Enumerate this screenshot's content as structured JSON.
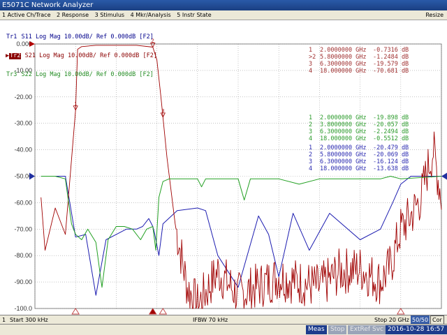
{
  "window": {
    "title": "E5071C Network Analyzer"
  },
  "menu": {
    "items": [
      "1 Active Ch/Trace",
      "2 Response",
      "3 Stimulus",
      "4 Mkr/Analysis",
      "5 Instr State"
    ],
    "resize_label": "Resize"
  },
  "traces_header": [
    {
      "id": "Tr1",
      "text": " S11 Log Mag 10.00dB/ Ref 0.000dB [F2]",
      "color": "#00008b"
    },
    {
      "id": "Tr2",
      "text": " S21 Log Mag 10.00dB/ Ref 0.000dB [F2]",
      "color": "#8b0000",
      "active": true
    },
    {
      "id": "Tr3",
      "text": " S22 Log Mag 10.00dB/ Ref 0.000dB [F2]",
      "color": "#228b22"
    }
  ],
  "status": {
    "channel": "1",
    "start": "Start 300 kHz",
    "ifbw": "IFBW 70 kHz",
    "stop": "Stop 20 GHz",
    "cor": "Cor"
  },
  "bottom": {
    "meas": "Meas",
    "stop": "Stop",
    "extref": "ExtRef",
    "svc": "Svc",
    "datetime": "2016-10-28 16:57"
  },
  "colors": {
    "s11": "#1c1cb0",
    "s21": "#a00000",
    "s22": "#22a022",
    "grid": "#a0a0a0"
  },
  "chart_data": {
    "type": "line",
    "ylim": [
      -100,
      0
    ],
    "xlim_ghz": [
      0.0003,
      20
    ],
    "y_tick_labels": [
      "0.000",
      "-10.00",
      "-20.00",
      "-30.00",
      "-40.00",
      "-50.00",
      "-60.00",
      "-70.00",
      "-80.00",
      "-90.00",
      "-100.0"
    ],
    "y_ticks": [
      0,
      -10,
      -20,
      -30,
      -40,
      -50,
      -60,
      -70,
      -80,
      -90,
      -100
    ],
    "grid": true,
    "series": [
      {
        "name": "S11",
        "x": [
          0.3,
          1.5,
          2.0,
          2.5,
          3.0,
          3.5,
          4.0,
          4.5,
          5.0,
          5.3,
          5.6,
          5.8,
          5.9,
          6.1,
          6.3,
          7.0,
          8.0,
          8.4,
          9.0,
          10.0,
          11.0,
          11.5,
          12.0,
          12.7,
          13.5,
          14.5,
          16.0,
          17.0,
          17.6,
          18.0,
          18.5,
          19.0,
          20.0
        ],
        "y": [
          -50,
          -50,
          -73,
          -72,
          -95,
          -74,
          -72,
          -70,
          -70,
          -69,
          -66,
          -69,
          -72,
          -80,
          -68,
          -63,
          -62,
          -63,
          -80,
          -92,
          -65,
          -72,
          -88,
          -64,
          -78,
          -64,
          -74,
          -70,
          -60,
          -53,
          -50,
          -50,
          -50
        ]
      },
      {
        "name": "S21",
        "x": [
          0.3,
          0.5,
          1.0,
          1.5,
          2.0,
          2.1,
          2.3,
          3.0,
          4.0,
          5.0,
          5.8,
          6.0,
          6.2,
          6.5,
          6.9,
          7.5,
          8.0,
          9.0,
          10.0,
          12.0,
          14.0,
          15.0,
          16.0,
          17.0,
          17.5,
          18.0,
          18.5,
          19.0,
          19.3,
          19.6,
          20.0
        ],
        "y": [
          -58,
          -78,
          -62,
          -72,
          -25,
          -2,
          -1,
          -0.5,
          -0.5,
          -0.5,
          -1.2,
          -6,
          -20,
          -43,
          -68,
          -92,
          -99,
          -86,
          -95,
          -88,
          -92,
          -86,
          -85,
          -90,
          -84,
          -70,
          -65,
          -58,
          -48,
          -40,
          -58
        ]
      },
      {
        "name": "S22",
        "x": [
          0.3,
          1.0,
          1.5,
          1.8,
          2.0,
          2.3,
          2.6,
          3.0,
          3.3,
          3.6,
          4.0,
          4.4,
          4.8,
          5.2,
          5.5,
          5.8,
          5.95,
          6.1,
          6.3,
          6.6,
          8.0,
          8.2,
          8.4,
          10.0,
          10.3,
          10.6,
          12.0,
          13.0,
          14.0,
          15.0,
          16.0,
          17.0,
          17.5,
          18.0,
          20.0
        ],
        "y": [
          -50,
          -50,
          -51,
          -68,
          -72,
          -74,
          -70,
          -75,
          -92,
          -74,
          -69,
          -69,
          -70,
          -74,
          -70,
          -69,
          -78,
          -58,
          -52,
          -51,
          -51,
          -54,
          -51,
          -51,
          -59,
          -51,
          -51,
          -53,
          -51,
          -51,
          -51,
          -51,
          -50,
          -51,
          -50
        ]
      }
    ],
    "marker_tables": [
      {
        "series": "S21",
        "color": "#a03030",
        "rows": [
          {
            "no": "1",
            "freq": "2.0000000 GHz",
            "value": "-0.7316 dB"
          },
          {
            "no": ">2",
            "freq": "5.8000000 GHz",
            "value": "-1.2484 dB"
          },
          {
            "no": "3",
            "freq": "6.3000000 GHz",
            "value": "-19.579 dB"
          },
          {
            "no": "4",
            "freq": "18.000000 GHz",
            "value": "-70.681 dB"
          }
        ]
      },
      {
        "series": "S22",
        "color": "#2a9a2a",
        "rows": [
          {
            "no": "1",
            "freq": "2.0000000 GHz",
            "value": "-19.898 dB"
          },
          {
            "no": "2",
            "freq": "3.8000000 GHz",
            "value": "-20.057 dB"
          },
          {
            "no": "3",
            "freq": "6.3000000 GHz",
            "value": "-2.2494 dB"
          },
          {
            "no": "4",
            "freq": "18.000000 GHz",
            "value": "-0.5512 dB"
          }
        ]
      },
      {
        "series": "S11",
        "color": "#2a2ab0",
        "rows": [
          {
            "no": "1",
            "freq": "2.0000000 GHz",
            "value": "-20.479 dB"
          },
          {
            "no": "2",
            "freq": "5.8000000 GHz",
            "value": "-20.069 dB"
          },
          {
            "no": "3",
            "freq": "6.3000000 GHz",
            "value": "-16.124 dB"
          },
          {
            "no": "4",
            "freq": "18.000000 GHz",
            "value": "-13.638 dB"
          }
        ]
      }
    ]
  }
}
